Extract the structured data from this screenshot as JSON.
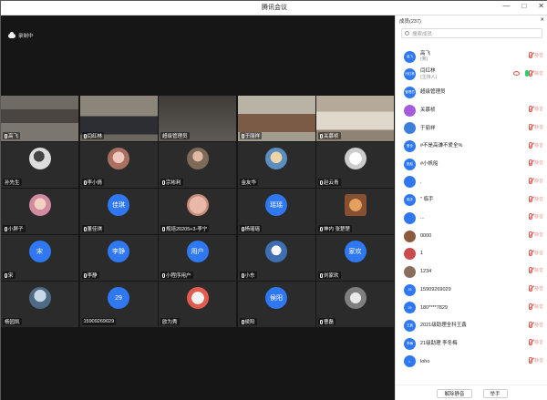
{
  "window": {
    "title": "腾讯会议",
    "controls": [
      "—",
      "□",
      "✕"
    ]
  },
  "recording": {
    "label": "录制中"
  },
  "tiles": [
    {
      "name": "高飞",
      "mic": true,
      "kind": "photo",
      "scene": "office1"
    },
    {
      "name": "闫红林",
      "mic": true,
      "kind": "photo",
      "scene": "office2"
    },
    {
      "name": "超级管理员",
      "mic": false,
      "kind": "photo",
      "scene": "blank",
      "active": true
    },
    {
      "name": "于丽祥",
      "mic": true,
      "kind": "photo",
      "scene": "office3"
    },
    {
      "name": "关慕祯",
      "mic": true,
      "kind": "photo",
      "scene": "office4"
    },
    {
      "name": "孙先生",
      "mic": false,
      "kind": "avatar",
      "avatar": "img1"
    },
    {
      "name": "李小倩",
      "mic": true,
      "kind": "avatar",
      "avatar": "img2"
    },
    {
      "name": "宗彬利",
      "mic": true,
      "kind": "avatar",
      "avatar": "img3"
    },
    {
      "name": "金友华",
      "mic": false,
      "kind": "avatar",
      "avatar": "img4"
    },
    {
      "name": "赵云青",
      "mic": true,
      "kind": "avatar",
      "avatar": "img5"
    },
    {
      "name": "小胖子",
      "mic": true,
      "kind": "avatar",
      "avatar": "img6"
    },
    {
      "name": "董佳琪",
      "mic": true,
      "kind": "avatar",
      "avatar": "blue",
      "text": "佳琪"
    },
    {
      "name": "规培20205+3-李宁",
      "mic": true,
      "kind": "avatar",
      "avatar": "img7"
    },
    {
      "name": "杨瑶瑶",
      "mic": true,
      "kind": "avatar",
      "avatar": "blue",
      "text": "瑶瑶"
    },
    {
      "name": "神内 张楚楚",
      "mic": true,
      "kind": "avatar",
      "avatar": "img8"
    },
    {
      "name": "宋",
      "mic": true,
      "kind": "avatar",
      "avatar": "blue",
      "text": "宋"
    },
    {
      "name": "李静",
      "mic": true,
      "kind": "avatar",
      "avatar": "blue",
      "text": "李静"
    },
    {
      "name": "小程序用户",
      "mic": true,
      "kind": "avatar",
      "avatar": "blue",
      "text": "用户"
    },
    {
      "name": "小东",
      "mic": true,
      "kind": "avatar",
      "avatar": "img9"
    },
    {
      "name": "刘家欢",
      "mic": true,
      "kind": "avatar",
      "avatar": "blue",
      "text": "家欢"
    },
    {
      "name": "杨园凯",
      "mic": false,
      "kind": "avatar",
      "avatar": "img11"
    },
    {
      "name": "15909269029",
      "mic": false,
      "kind": "avatar",
      "avatar": "blue",
      "text": "29"
    },
    {
      "name": "欧为秀",
      "mic": false,
      "kind": "avatar",
      "avatar": "img10"
    },
    {
      "name": "侯阳",
      "mic": true,
      "kind": "avatar",
      "avatar": "blue",
      "text": "侯阳"
    },
    {
      "name": "曹磊",
      "mic": true,
      "kind": "avatar",
      "avatar": "img12"
    }
  ],
  "panel": {
    "title": "成员(237)",
    "close": "✕",
    "search_placeholder": "搜索成员",
    "members": [
      {
        "avatar": "高飞",
        "name": "高飞",
        "sub": "(我)",
        "mute": "静音",
        "color": "#2f78f1"
      },
      {
        "avatar": "闫红林",
        "name": "闫红林",
        "sub": "(主持人)",
        "mute": "静音",
        "color": "#2f78f1",
        "live": true
      },
      {
        "avatar": "管理员",
        "name": "超级管理员",
        "sub": "",
        "mute": "",
        "color": "#2f78f1"
      },
      {
        "avatar": "",
        "name": "关慕桢",
        "sub": "",
        "mute": "静音",
        "color": "#a45cdb"
      },
      {
        "avatar": "",
        "name": "于丽祥",
        "sub": "",
        "mute": "静音",
        "color": "#3c7ed9"
      },
      {
        "avatar": "爱全",
        "name": "#不是高谦不爱全%",
        "sub": "",
        "mute": "静音",
        "color": "#2f78f1"
      },
      {
        "avatar": "帆船",
        "name": "#小帆船",
        "sub": "",
        "mute": "静音",
        "color": "#2f78f1"
      },
      {
        "avatar": "",
        "name": ".",
        "sub": "",
        "mute": "静音",
        "color": "#2f78f1"
      },
      {
        "avatar": "临手",
        "name": "\" 临手",
        "sub": "",
        "mute": "静音",
        "color": "#2f78f1"
      },
      {
        "avatar": "",
        "name": "...",
        "sub": "",
        "mute": "静音",
        "color": "#2f78f1"
      },
      {
        "avatar": "",
        "name": "0000",
        "sub": "",
        "mute": "静音",
        "color": "#8b5a3c"
      },
      {
        "avatar": "",
        "name": "1",
        "sub": "",
        "mute": "静音",
        "color": "#c94b4b"
      },
      {
        "avatar": "",
        "name": "1234",
        "sub": "",
        "mute": "静音",
        "color": "#8a6e5c"
      },
      {
        "avatar": "29",
        "name": "15909269029",
        "sub": "",
        "mute": "静音",
        "color": "#2f78f1"
      },
      {
        "avatar": "29",
        "name": "180****7829",
        "sub": "",
        "mute": "静音",
        "color": "#2f78f1"
      },
      {
        "avatar": "王鑫",
        "name": "2021级助理全科王鑫",
        "sub": "",
        "mute": "静音",
        "color": "#2f78f1"
      },
      {
        "avatar": "李梅",
        "name": "21级助理 李冬梅",
        "sub": "",
        "mute": "静音",
        "color": "#2f78f1"
      },
      {
        "avatar": "L",
        "name": "loho",
        "sub": "",
        "mute": "静音",
        "color": "#2f78f1"
      }
    ],
    "buttons": {
      "unmute_all": "解除静音",
      "raise_hand": "举手"
    }
  }
}
